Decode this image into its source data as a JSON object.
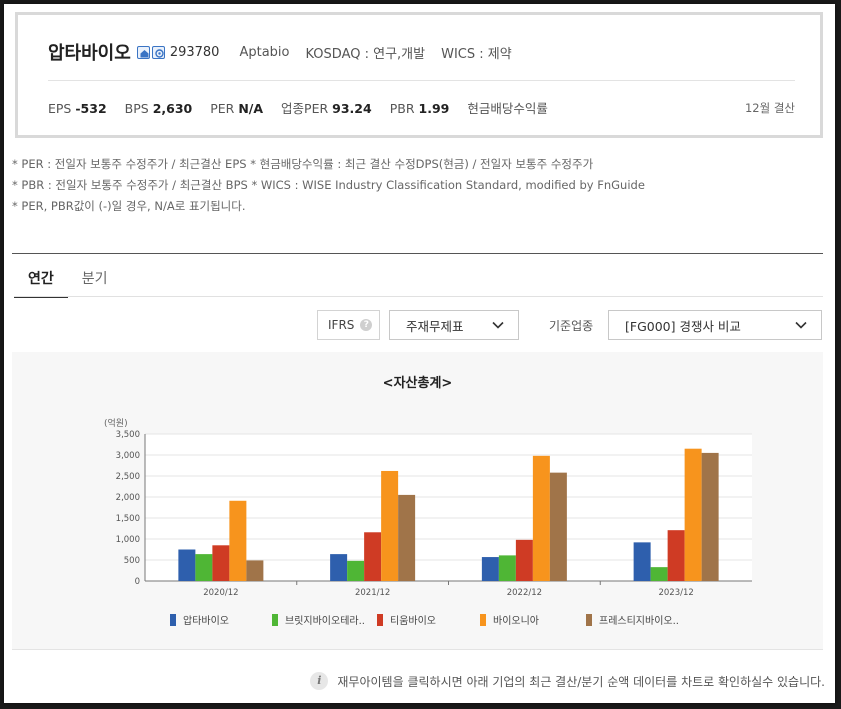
{
  "company": {
    "name": "압타바이오",
    "code": "293780",
    "english_name": "Aptabio",
    "market": "KOSDAQ : 연구,개발",
    "wics": "WICS : 제약",
    "icons": [
      "home-icon",
      "ir-icon"
    ]
  },
  "ratios": [
    {
      "label": "EPS",
      "value": "-532"
    },
    {
      "label": "BPS",
      "value": "2,630"
    },
    {
      "label": "PER",
      "value": "N/A"
    },
    {
      "label": "업종PER",
      "value": "93.24"
    },
    {
      "label": "PBR",
      "value": "1.99"
    },
    {
      "label": "현금배당수익률",
      "value": ""
    }
  ],
  "fiscal": "12월 결산",
  "notes": [
    "* PER : 전일자 보통주 수정주가 / 최근결산 EPS * 현금배당수익률 : 최근 결산 수정DPS(현금) / 전일자 보통주 수정주가",
    "* PBR : 전일자 보통주 수정주가 / 최근결산 BPS * WICS : WISE Industry Classification Standard, modified by FnGuide",
    "* PER, PBR값이 (-)일 경우, N/A로 표기됩니다."
  ],
  "tabs": [
    {
      "label": "연간",
      "active": true
    },
    {
      "label": "분기",
      "active": false
    }
  ],
  "filters": {
    "ifrs_label": "IFRS",
    "help_glyph": "?",
    "statement_select": "주재무제표",
    "industry_label": "기준업종",
    "industry_select": "[FG000] 경쟁사 비교"
  },
  "info_glyph": "i",
  "chart_data": {
    "type": "bar",
    "title": "<자산총계>",
    "ylabel": "(억원)",
    "ylim": [
      0,
      3500
    ],
    "yticks": [
      0,
      500,
      1000,
      1500,
      2000,
      2500,
      3000,
      3500
    ],
    "ytick_labels": [
      "0",
      "500",
      "1,000",
      "1,500",
      "2,000",
      "2,500",
      "3,000",
      "3,500"
    ],
    "categories": [
      "2020/12",
      "2021/12",
      "2022/12",
      "2023/12"
    ],
    "grid": true,
    "legend_position": "bottom",
    "series": [
      {
        "name": "압타바이오",
        "color": "#2e5fad",
        "values": [
          750,
          640,
          570,
          920
        ]
      },
      {
        "name": "브릿지바이오테라..",
        "color": "#4fb635",
        "values": [
          640,
          480,
          610,
          330
        ]
      },
      {
        "name": "티움바이오",
        "color": "#cf3b24",
        "values": [
          850,
          1160,
          980,
          1210
        ]
      },
      {
        "name": "바이오니아",
        "color": "#f7941d",
        "values": [
          1910,
          2620,
          2980,
          3150
        ]
      },
      {
        "name": "프레스티지바이오..",
        "color": "#a07449",
        "values": [
          490,
          2050,
          2580,
          3050
        ]
      }
    ]
  },
  "info_text": "재무아이템을 클릭하시면 아래 기업의 최근 결산/분기 순액 데이터를 차트로 확인하실수 있습니다."
}
